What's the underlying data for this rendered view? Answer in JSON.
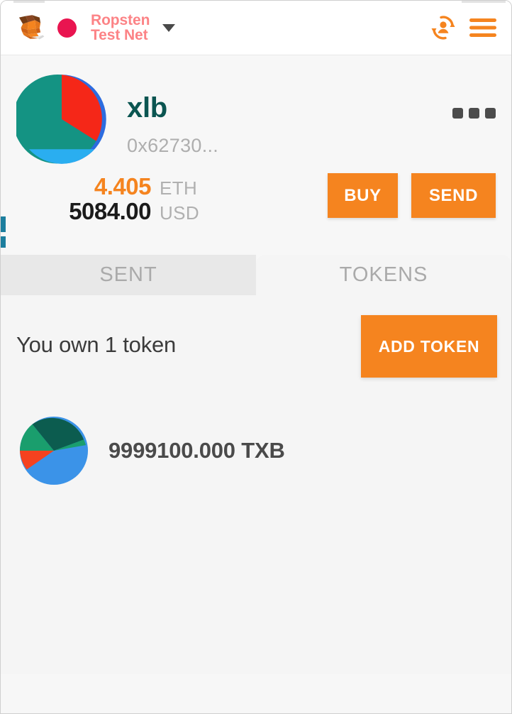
{
  "header": {
    "logo_icon": "metamask-fox-logo",
    "network": {
      "status_dot_color": "#e91550",
      "name": "Ropsten\nTest Net",
      "name_line1": "Ropsten",
      "name_line2": "Test Net",
      "caret_icon": "chevron-down-icon",
      "text_color": "#fc8386"
    },
    "account_switch_icon": "account-switch-icon",
    "menu_icon": "hamburger-menu-icon",
    "icon_color": "#f5841f"
  },
  "account": {
    "identicon_name": "account-identicon",
    "name": "xlb",
    "address": "0x62730...",
    "options_icon": "kebab-menu-icon",
    "balances": [
      {
        "amount": "4.405",
        "unit": "ETH",
        "color": "#f5841f"
      },
      {
        "amount": "5084.00",
        "unit": "USD",
        "color": "#1b1b1b"
      }
    ],
    "actions": [
      {
        "label": "BUY",
        "name": "buy-button"
      },
      {
        "label": "SEND",
        "name": "send-button"
      }
    ]
  },
  "tabs": [
    {
      "label": "SENT",
      "name": "tab-sent",
      "active": false
    },
    {
      "label": "TOKENS",
      "name": "tab-tokens",
      "active": true
    }
  ],
  "tokens_pane": {
    "summary": "You own 1 token",
    "add_token_label": "ADD TOKEN",
    "tokens": [
      {
        "identicon_name": "token-identicon",
        "balance": "9999100.000 TXB"
      }
    ]
  },
  "theme": {
    "accent_orange": "#f5841f",
    "network_pink": "#fc8386",
    "account_name_teal": "#0b5551",
    "panel_bg": "#f7f7f7",
    "tab_active_bg": "#f5f5f5",
    "tab_inactive_bg": "#e8e8e8"
  }
}
